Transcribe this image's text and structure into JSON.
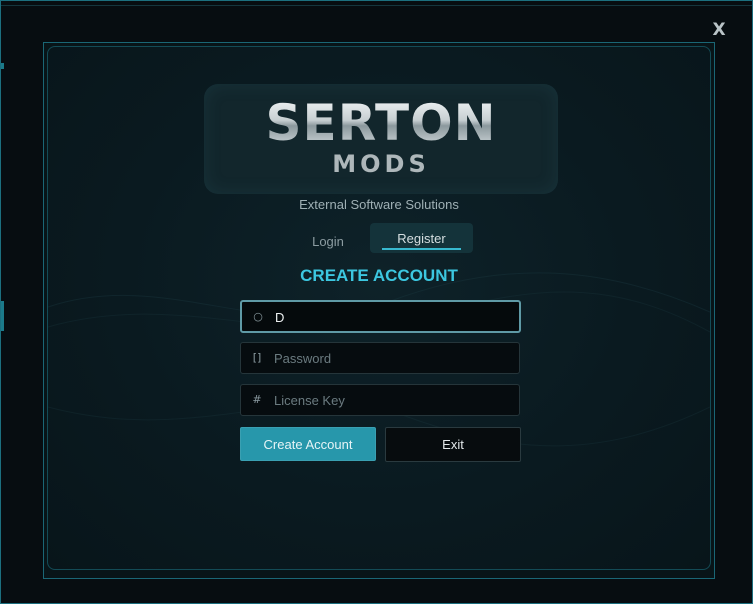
{
  "window": {
    "close_label": "X"
  },
  "logo": {
    "line1": "SERTON",
    "line2": "MODS"
  },
  "tagline": "External Software Solutions",
  "tabs": [
    {
      "label": "Login",
      "active": false
    },
    {
      "label": "Register",
      "active": true
    }
  ],
  "heading": "CREATE ACCOUNT",
  "form": {
    "username": {
      "icon": "○",
      "icon_name": "user-icon",
      "value": "D",
      "placeholder": ""
    },
    "password": {
      "icon": "[]",
      "icon_name": "lock-icon",
      "value": "",
      "placeholder": "Password"
    },
    "license": {
      "icon": "#",
      "icon_name": "key-icon",
      "value": "",
      "placeholder": "License Key"
    }
  },
  "buttons": {
    "create_label": "Create Account",
    "exit_label": "Exit"
  },
  "colors": {
    "accent": "#3cc7e0",
    "primary_button": "#2797ab",
    "background": "#0a1a20"
  }
}
